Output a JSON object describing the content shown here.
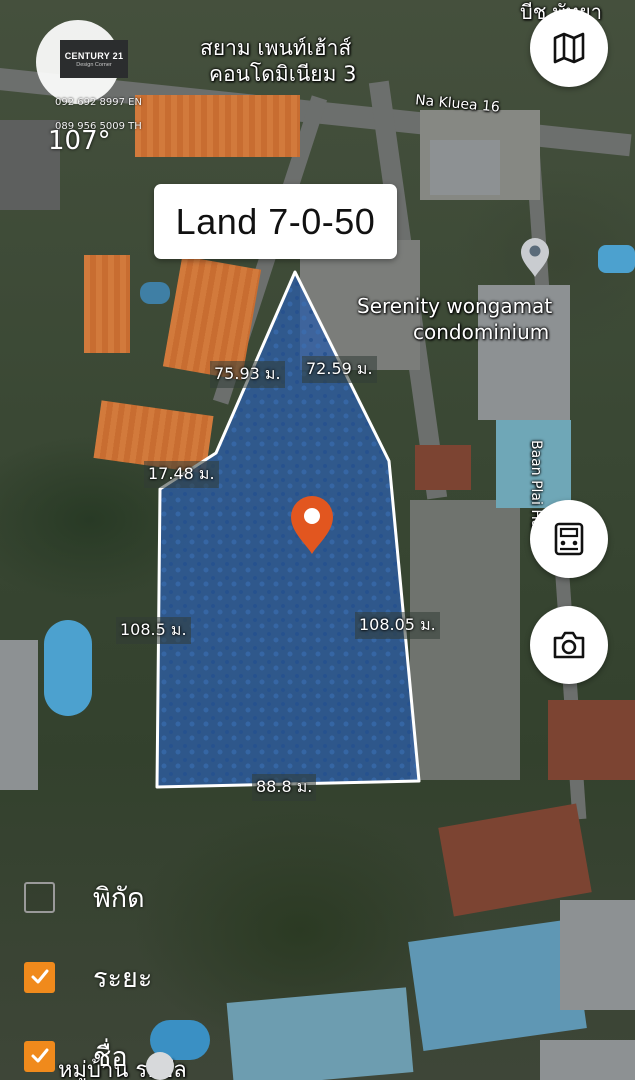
{
  "logo": {
    "brand": "CENTURY 21",
    "subtitle": "Design Corner"
  },
  "contact": {
    "phone_en": "092 692 8997 EN",
    "phone_th": "089 956 5009 TH"
  },
  "compass_heading": "107°",
  "title": "Land 7-0-50",
  "place_labels": {
    "top_right_partial": "บีช พัทยา",
    "siam_penthouse_line1": "สยาม เพนท์เฮ้าส์",
    "siam_penthouse_line2": "คอนโดมิเนียม 3",
    "road_na_kluea": "Na Kluea 16",
    "serenity_line1": "Serenity wongamat",
    "serenity_line2": "condominium",
    "baan_plai_haad": "Baan Plai Haad"
  },
  "measurements": {
    "top_left": "75.93 ม.",
    "top_right": "72.59 ม.",
    "left_upper": "17.48 ม.",
    "left": "108.5 ม.",
    "right": "108.05 ม.",
    "bottom": "88.8 ม."
  },
  "buttons": {
    "map_icon": "map-icon",
    "calculator_icon": "calculator-icon",
    "camera_icon": "camera-icon"
  },
  "layers": [
    {
      "label": "พิกัด",
      "checked": false
    },
    {
      "label": "ระยะ",
      "checked": true
    },
    {
      "label": "ชื่อ",
      "checked": true
    }
  ],
  "bottom_partial_label": "หมู่บ้าน รอยัล",
  "colors": {
    "accent": "#f08a1c",
    "pin": "#e2561f",
    "parcel_fill": "#2f5fa8",
    "parcel_outline": "#ffffff"
  }
}
